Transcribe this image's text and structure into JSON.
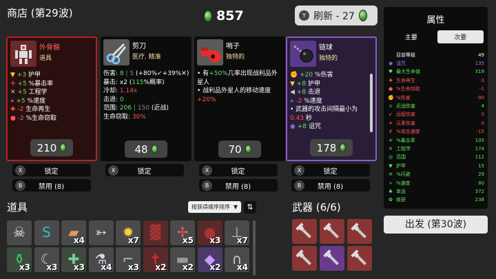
{
  "header": {
    "title": "商店 (第29波)",
    "money": "857"
  },
  "refresh": {
    "key": "Y",
    "label": "刷新 - 27"
  },
  "cards": [
    {
      "name": "外骨骼",
      "tag": "道具",
      "price": "210",
      "stats": [
        {
          "icon": "shield-icon",
          "parts": [
            {
              "t": "+3",
              "c": "#5ee65e"
            },
            {
              "t": " 护甲",
              "c": "#fff"
            }
          ]
        },
        {
          "icon": "crosshair-icon",
          "parts": [
            {
              "t": "+5",
              "c": "#5ee65e"
            },
            {
              "t": " %暴击率",
              "c": "#fff"
            }
          ]
        },
        {
          "icon": "wrench-icon",
          "parts": [
            {
              "t": "+5",
              "c": "#5ee65e"
            },
            {
              "t": " 工程学",
              "c": "#fff"
            }
          ]
        },
        {
          "icon": "speed-icon",
          "parts": [
            {
              "t": "+5",
              "c": "#5ee65e"
            },
            {
              "t": " %速度",
              "c": "#fff"
            }
          ]
        },
        {
          "icon": "heart-icon",
          "parts": [
            {
              "t": "-2",
              "c": "#ff5555"
            },
            {
              "t": " 生命再生",
              "c": "#fff"
            }
          ]
        },
        {
          "icon": "leech-icon",
          "parts": [
            {
              "t": "-2",
              "c": "#ff5555"
            },
            {
              "t": " %生命窃取",
              "c": "#fff"
            }
          ]
        }
      ]
    },
    {
      "name": "剪刀",
      "tag": "医疗, 精准",
      "price": "48",
      "stats": [
        {
          "parts": [
            {
              "t": "伤害: ",
              "c": "#fff"
            },
            {
              "t": "8",
              "c": "#5ee65e"
            },
            {
              "t": " | 5 ",
              "c": "#888"
            },
            {
              "t": "(+80%",
              "c": "#fff"
            },
            {
              "t": "✔",
              "c": "#5ee65e"
            },
            {
              "t": "+39%",
              "c": "#fff"
            },
            {
              "t": "✕",
              "c": "#fff"
            },
            {
              "t": ")",
              "c": "#fff"
            }
          ]
        },
        {
          "parts": [
            {
              "t": "暴击: ",
              "c": "#fff"
            },
            {
              "t": "x2",
              "c": "#fff"
            },
            {
              "t": " (",
              "c": "#fff"
            },
            {
              "t": "115",
              "c": "#5ee65e"
            },
            {
              "t": "%概率)",
              "c": "#fff"
            }
          ]
        },
        {
          "parts": [
            {
              "t": "冷却: ",
              "c": "#fff"
            },
            {
              "t": "1.14s",
              "c": "#ff5555"
            }
          ]
        },
        {
          "parts": [
            {
              "t": "击退: ",
              "c": "#fff"
            },
            {
              "t": "0",
              "c": "#5ee65e"
            }
          ]
        },
        {
          "parts": [
            {
              "t": "范围: ",
              "c": "#fff"
            },
            {
              "t": "206",
              "c": "#5ee65e"
            },
            {
              "t": " | 150 ",
              "c": "#888"
            },
            {
              "t": "(近战)",
              "c": "#fff"
            }
          ]
        },
        {
          "parts": [
            {
              "t": "生命窃取: ",
              "c": "#fff"
            },
            {
              "t": "30%",
              "c": "#ff5555"
            }
          ]
        }
      ]
    },
    {
      "name": "哨子",
      "tag": "独特的",
      "price": "70",
      "stats": [
        {
          "bullet": true,
          "parts": [
            {
              "t": "有",
              "c": "#fff"
            },
            {
              "t": "+50%",
              "c": "#5ee65e"
            },
            {
              "t": "几率出现战利品外星人",
              "c": "#fff"
            }
          ]
        },
        {
          "bullet": true,
          "parts": [
            {
              "t": "战利品外星人的移动速度",
              "c": "#fff"
            }
          ]
        },
        {
          "parts": [
            {
              "t": "+20%",
              "c": "#ff5555"
            }
          ]
        }
      ]
    },
    {
      "name": "链球",
      "tag": "独特的",
      "price": "178",
      "stats": [
        {
          "icon": "fist-icon",
          "parts": [
            {
              "t": "+20",
              "c": "#5ee65e"
            },
            {
              "t": " %伤害",
              "c": "#fff"
            }
          ]
        },
        {
          "icon": "shield-icon",
          "parts": [
            {
              "t": "+8",
              "c": "#5ee65e"
            },
            {
              "t": " 护甲",
              "c": "#fff"
            }
          ]
        },
        {
          "icon": "knockback-icon",
          "parts": [
            {
              "t": "+8",
              "c": "#5ee65e"
            },
            {
              "t": " 击退",
              "c": "#fff"
            }
          ]
        },
        {
          "icon": "speed-icon",
          "parts": [
            {
              "t": "-2",
              "c": "#ff5555"
            },
            {
              "t": " %速度",
              "c": "#fff"
            }
          ]
        },
        {
          "bullet": true,
          "parts": [
            {
              "t": "武器的攻击间隔最小为",
              "c": "#fff"
            }
          ]
        },
        {
          "parts": [
            {
              "t": "0.43",
              "c": "#ff5555"
            },
            {
              "t": " 秒",
              "c": "#fff"
            }
          ]
        },
        {
          "icon": "curse-icon",
          "parts": [
            {
              "t": "+8",
              "c": "#5ee65e"
            },
            {
              "t": " 诅咒",
              "c": "#fff"
            }
          ]
        }
      ]
    }
  ],
  "actions": {
    "lock_key": "X",
    "lock": "锁定",
    "ban_key": "B",
    "ban": "禁用 (8)"
  },
  "items_section": {
    "title": "道具",
    "sort": "按获得顺序排序"
  },
  "items": [
    {
      "icon": "skull-icon",
      "qty": ""
    },
    {
      "icon": "snake-icon",
      "qty": ""
    },
    {
      "icon": "cake-icon",
      "qty": "x4"
    },
    {
      "icon": "fish-icon",
      "qty": ""
    },
    {
      "icon": "bee-icon",
      "qty": "x7"
    },
    {
      "icon": "armor-icon",
      "qty": ""
    },
    {
      "icon": "propeller-hat-icon",
      "qty": "x5"
    },
    {
      "icon": "bomb-icon",
      "qty": "x3"
    },
    {
      "icon": "turret-icon",
      "qty": "x7"
    },
    {
      "icon": "potion-icon",
      "qty": "x3"
    },
    {
      "icon": "claw-icon",
      "qty": "x3"
    },
    {
      "icon": "medkit-icon",
      "qty": "x3"
    },
    {
      "icon": "flask-icon",
      "qty": "x4"
    },
    {
      "icon": "crane-icon",
      "qty": "x3"
    },
    {
      "icon": "dagger-icon",
      "qty": "x2"
    },
    {
      "icon": "rock-icon",
      "qty": "x2"
    },
    {
      "icon": "crystal-icon",
      "qty": "x2"
    },
    {
      "icon": "magnet-icon",
      "qty": "x4"
    }
  ],
  "weapons_section": {
    "title": "武器 (6/6)"
  },
  "weapons": [
    {
      "icon": "wrench-icon"
    },
    {
      "icon": "wrench-icon"
    },
    {
      "icon": "wrench-icon"
    },
    {
      "icon": "wrench-icon"
    },
    {
      "icon": "wrench-icon",
      "purple": true
    },
    {
      "icon": "wrench-icon"
    }
  ],
  "attributes": {
    "title": "属性",
    "tab_main": "主要",
    "tab_secondary": "次要",
    "rows": [
      {
        "label": "目前等级",
        "value": "49",
        "color": "#fff",
        "icon": ""
      },
      {
        "label": "诅咒",
        "value": "135",
        "color": "#b070ff",
        "icon": "◉"
      },
      {
        "label": "最大生命值",
        "value": "319",
        "color": "#5ee65e",
        "icon": "♥"
      },
      {
        "label": "生命再生",
        "value": "-3",
        "color": "#ff5555",
        "icon": "✚"
      },
      {
        "label": "%生命窃取",
        "value": "-1",
        "color": "#ff5555",
        "icon": "●"
      },
      {
        "label": "%伤害",
        "value": "-90",
        "color": "#ff5555",
        "icon": "✊"
      },
      {
        "label": "近战伤害",
        "value": "4",
        "color": "#5ee65e",
        "icon": "⚔"
      },
      {
        "label": "远程伤害",
        "value": "0",
        "color": "#ff5555",
        "icon": "➹"
      },
      {
        "label": "元素伤害",
        "value": "0",
        "color": "#ff5555",
        "icon": "✦"
      },
      {
        "label": "%攻击速度",
        "value": "-15",
        "color": "#ff5555",
        "icon": "✗"
      },
      {
        "label": "%暴击率",
        "value": "105",
        "color": "#5ee65e",
        "icon": "✛"
      },
      {
        "label": "工程学",
        "value": "174",
        "color": "#5ee65e",
        "icon": "✕"
      },
      {
        "label": "范围",
        "value": "112",
        "color": "#5ee65e",
        "icon": "◎"
      },
      {
        "label": "护甲",
        "value": "15",
        "color": "#5ee65e",
        "icon": "▼"
      },
      {
        "label": "%闪避",
        "value": "29",
        "color": "#5ee65e",
        "icon": "≋"
      },
      {
        "label": "%速度",
        "value": "80",
        "color": "#5ee65e",
        "icon": "»"
      },
      {
        "label": "幸运",
        "value": "372",
        "color": "#5ee65e",
        "icon": "♣"
      },
      {
        "label": "收获",
        "value": "238",
        "color": "#5ee65e",
        "icon": "✿"
      }
    ]
  },
  "depart": "出发 (第30波)"
}
